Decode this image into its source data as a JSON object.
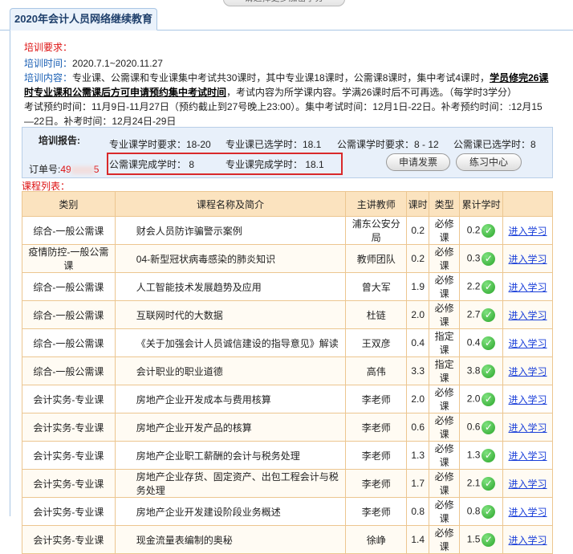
{
  "top_button": "请选择更多加密学分",
  "tab": "2020年会计人员网络继续教育",
  "requirements": {
    "title": "培训要求：",
    "time_label": "培训时间：",
    "time_value": "2020.7.1~2020.11.27",
    "content_label": "培训内容：",
    "content_text": "专业课、公需课和专业课集中考试共30课时，其中专业课18课时，公需课8课时，集中考试4课时，",
    "content_bold1": "学员修完26课",
    "content_bold2": "时专业课和公需课后方可申请预约集中考试时间",
    "content_rest": "，考试内容为所学课内容。学满26课时后不可再选。（每学时3学分）",
    "exam_line": "考试预约时间：11月9日-11月27日（预约截止到27号晚上23:00）。集中考试时间：12月1日-22日。补考预约时间：:12月15",
    "exam_line2": "—22日。补考时间：12月24日-29日"
  },
  "report": {
    "title": "培训报告:",
    "order_label": "订单号:",
    "order_prefix": "49",
    "order_suffix": "5",
    "prof_required": "专业课学时要求：18-20",
    "prof_selected": "专业课已选学时：18.1",
    "public_required": "公需课学时要求：8 - 12",
    "public_selected": "公需课已选学时：8",
    "public_done": "公需课完成学时：  8",
    "prof_done": "专业课完成学时：  18.1",
    "invoice_button": "申请发票",
    "practice_button": "练习中心"
  },
  "list_title": "课程列表：",
  "columns": [
    "类别",
    "课程名称及简介",
    "主讲教师",
    "课时",
    "类型",
    "累计学时",
    ""
  ],
  "rows": [
    {
      "cat": "综合-一般公需课",
      "name": "财会人员防诈骗警示案例",
      "teacher": "浦东公安分局",
      "hours": "0.2",
      "type": "必修课",
      "acc": "0.2",
      "link": "进入学习"
    },
    {
      "cat": "疫情防控-一般公需课",
      "name": "04-新型冠状病毒感染的肺炎知识",
      "teacher": "教师团队",
      "hours": "0.2",
      "type": "必修课",
      "acc": "0.3",
      "link": "进入学习"
    },
    {
      "cat": "综合-一般公需课",
      "name": "人工智能技术发展趋势及应用",
      "teacher": "曾大军",
      "hours": "1.9",
      "type": "必修课",
      "acc": "2.2",
      "link": "进入学习"
    },
    {
      "cat": "综合-一般公需课",
      "name": "互联网时代的大数据",
      "teacher": "杜链",
      "hours": "2.0",
      "type": "必修课",
      "acc": "2.7",
      "link": "进入学习"
    },
    {
      "cat": "综合-一般公需课",
      "name": "《关于加强会计人员诚信建设的指导意见》解读",
      "teacher": "王双彦",
      "hours": "0.4",
      "type": "指定课",
      "acc": "0.4",
      "link": "进入学习"
    },
    {
      "cat": "综合-一般公需课",
      "name": "会计职业的职业道德",
      "teacher": "高伟",
      "hours": "3.3",
      "type": "指定课",
      "acc": "3.8",
      "link": "进入学习"
    },
    {
      "cat": "会计实务-专业课",
      "name": "房地产企业开发成本与费用核算",
      "teacher": "李老师",
      "hours": "2.0",
      "type": "必修课",
      "acc": "2.0",
      "link": "进入学习"
    },
    {
      "cat": "会计实务-专业课",
      "name": "房地产企业开发产品的核算",
      "teacher": "李老师",
      "hours": "0.6",
      "type": "必修课",
      "acc": "0.6",
      "link": "进入学习"
    },
    {
      "cat": "会计实务-专业课",
      "name": "房地产企业职工薪酬的会计与税务处理",
      "teacher": "李老师",
      "hours": "1.3",
      "type": "必修课",
      "acc": "1.3",
      "link": "进入学习"
    },
    {
      "cat": "会计实务-专业课",
      "name": "房地产企业存货、固定资产、出包工程会计与税务处理",
      "teacher": "李老师",
      "hours": "1.7",
      "type": "必修课",
      "acc": "2.1",
      "link": "进入学习"
    },
    {
      "cat": "会计实务-专业课",
      "name": "房地产企业开发建设阶段业务概述",
      "teacher": "李老师",
      "hours": "0.8",
      "type": "必修课",
      "acc": "0.8",
      "link": "进入学习"
    },
    {
      "cat": "会计实务-专业课",
      "name": "现金流量表编制的奥秘",
      "teacher": "徐峥",
      "hours": "1.4",
      "type": "必修课",
      "acc": "1.5",
      "link": "进入学习"
    }
  ],
  "colors": {
    "accent_red": "#d11111",
    "link_blue": "#1a3fd9",
    "header_bg": "#fbe3bf",
    "highlight_border": "#d9292b"
  }
}
